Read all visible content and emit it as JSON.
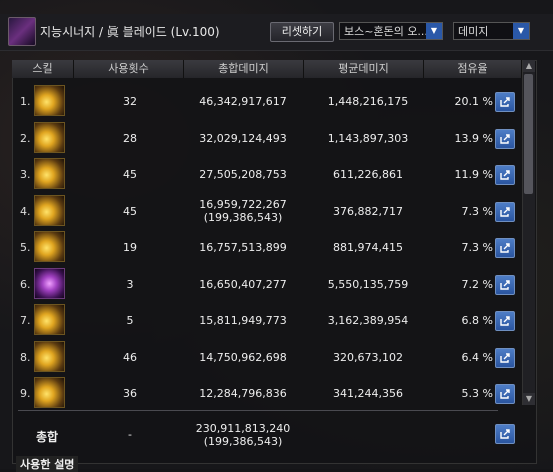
{
  "header": {
    "character": "지능시너지 / 眞 블레이드 (Lv.100)",
    "reset_label": "리셋하기",
    "boss_select": "보스~혼돈의 오...",
    "metric_select": "데미지"
  },
  "table": {
    "columns": [
      "스킬",
      "사용횟수",
      "총합데미지",
      "평균데미지",
      "점유율"
    ],
    "rows": [
      {
        "rank": "1.",
        "count": "32",
        "total": "46,342,917,617",
        "total2": "",
        "avg": "1,448,216,175",
        "share": "20.1 %"
      },
      {
        "rank": "2.",
        "count": "28",
        "total": "32,029,124,493",
        "total2": "",
        "avg": "1,143,897,303",
        "share": "13.9 %"
      },
      {
        "rank": "3.",
        "count": "45",
        "total": "27,505,208,753",
        "total2": "",
        "avg": "611,226,861",
        "share": "11.9 %"
      },
      {
        "rank": "4.",
        "count": "45",
        "total": "16,959,722,267",
        "total2": "(199,386,543)",
        "avg": "376,882,717",
        "share": "7.3 %"
      },
      {
        "rank": "5.",
        "count": "19",
        "total": "16,757,513,899",
        "total2": "",
        "avg": "881,974,415",
        "share": "7.3 %"
      },
      {
        "rank": "6.",
        "count": "3",
        "total": "16,650,407,277",
        "total2": "",
        "avg": "5,550,135,759",
        "share": "7.2 %"
      },
      {
        "rank": "7.",
        "count": "5",
        "total": "15,811,949,773",
        "total2": "",
        "avg": "3,162,389,954",
        "share": "6.8 %"
      },
      {
        "rank": "8.",
        "count": "46",
        "total": "14,750,962,698",
        "total2": "",
        "avg": "320,673,102",
        "share": "6.4 %"
      },
      {
        "rank": "9.",
        "count": "36",
        "total": "12,284,796,836",
        "total2": "",
        "avg": "341,244,356",
        "share": "5.3 %"
      }
    ]
  },
  "total": {
    "label": "총합",
    "count": "-",
    "total": "230,911,813,240",
    "total2": "(199,386,543)"
  },
  "footer_tab": "사용한 설명",
  "icons": {
    "share": "share-icon",
    "dropdown": "chevron-down-icon",
    "scroll_up": "arrow-up-icon",
    "scroll_down": "arrow-down-icon"
  }
}
